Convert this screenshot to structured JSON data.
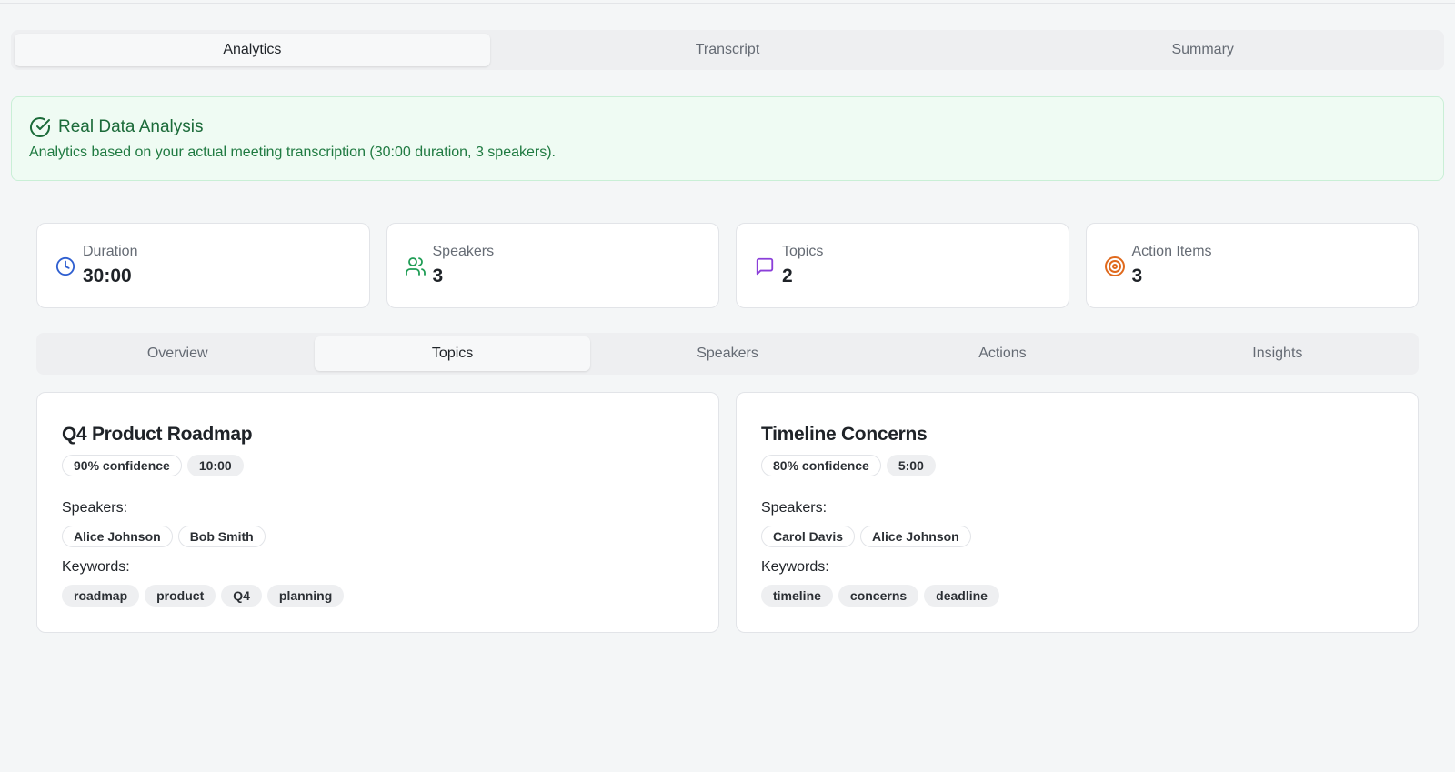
{
  "main_tabs": [
    {
      "label": "Analytics",
      "active": true
    },
    {
      "label": "Transcript",
      "active": false
    },
    {
      "label": "Summary",
      "active": false
    }
  ],
  "banner": {
    "title": "Real Data Analysis",
    "text": "Analytics based on your actual meeting transcription (30:00 duration, 3 speakers).",
    "icon": "check-circle-icon",
    "color": "#1c6b3a"
  },
  "stats": [
    {
      "label": "Duration",
      "value": "30:00",
      "icon": "clock-icon",
      "color": "#2f5fd0"
    },
    {
      "label": "Speakers",
      "value": "3",
      "icon": "users-icon",
      "color": "#1f9d55"
    },
    {
      "label": "Topics",
      "value": "2",
      "icon": "message-square-icon",
      "color": "#8b3fd9"
    },
    {
      "label": "Action Items",
      "value": "3",
      "icon": "target-icon",
      "color": "#e0691c"
    }
  ],
  "sub_tabs": [
    {
      "label": "Overview",
      "active": false
    },
    {
      "label": "Topics",
      "active": true
    },
    {
      "label": "Speakers",
      "active": false
    },
    {
      "label": "Actions",
      "active": false
    },
    {
      "label": "Insights",
      "active": false
    }
  ],
  "topics": [
    {
      "title": "Q4 Product Roadmap",
      "confidence": "90% confidence",
      "duration": "10:00",
      "speakers_label": "Speakers:",
      "speakers": [
        "Alice Johnson",
        "Bob Smith"
      ],
      "keywords_label": "Keywords:",
      "keywords": [
        "roadmap",
        "product",
        "Q4",
        "planning"
      ]
    },
    {
      "title": "Timeline Concerns",
      "confidence": "80% confidence",
      "duration": "5:00",
      "speakers_label": "Speakers:",
      "speakers": [
        "Carol Davis",
        "Alice Johnson"
      ],
      "keywords_label": "Keywords:",
      "keywords": [
        "timeline",
        "concerns",
        "deadline"
      ]
    }
  ]
}
